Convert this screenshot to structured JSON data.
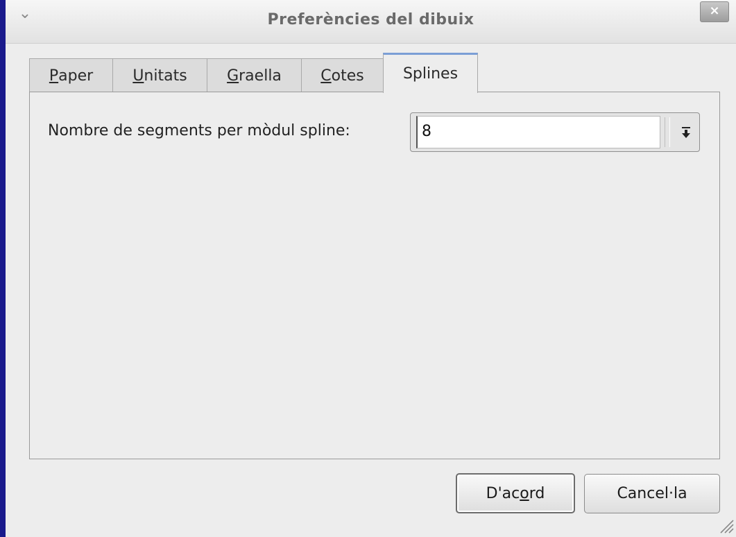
{
  "window": {
    "title": "Preferències del dibuix",
    "close_label": "×"
  },
  "tabs": [
    {
      "label": "Paper",
      "mnemonic": "P",
      "rest": "aper",
      "active": false
    },
    {
      "label": "Unitats",
      "mnemonic": "U",
      "rest": "nitats",
      "active": false
    },
    {
      "label": "Graella",
      "mnemonic": "G",
      "rest": "raella",
      "active": false
    },
    {
      "label": "Cotes",
      "mnemonic": "C",
      "rest": "otes",
      "active": false
    },
    {
      "label": "Splines",
      "mnemonic": "",
      "rest": "Splines",
      "active": true
    }
  ],
  "splines": {
    "segments_label": "Nombre de segments per mòdul spline:",
    "segments_value": "8"
  },
  "buttons": {
    "ok_pre": "D'ac",
    "ok_mnemonic": "o",
    "ok_post": "rd",
    "cancel": "Cancel·la"
  },
  "colors": {
    "active_tab_accent": "#7b9ed6",
    "window_border": "#1a1a8c"
  }
}
